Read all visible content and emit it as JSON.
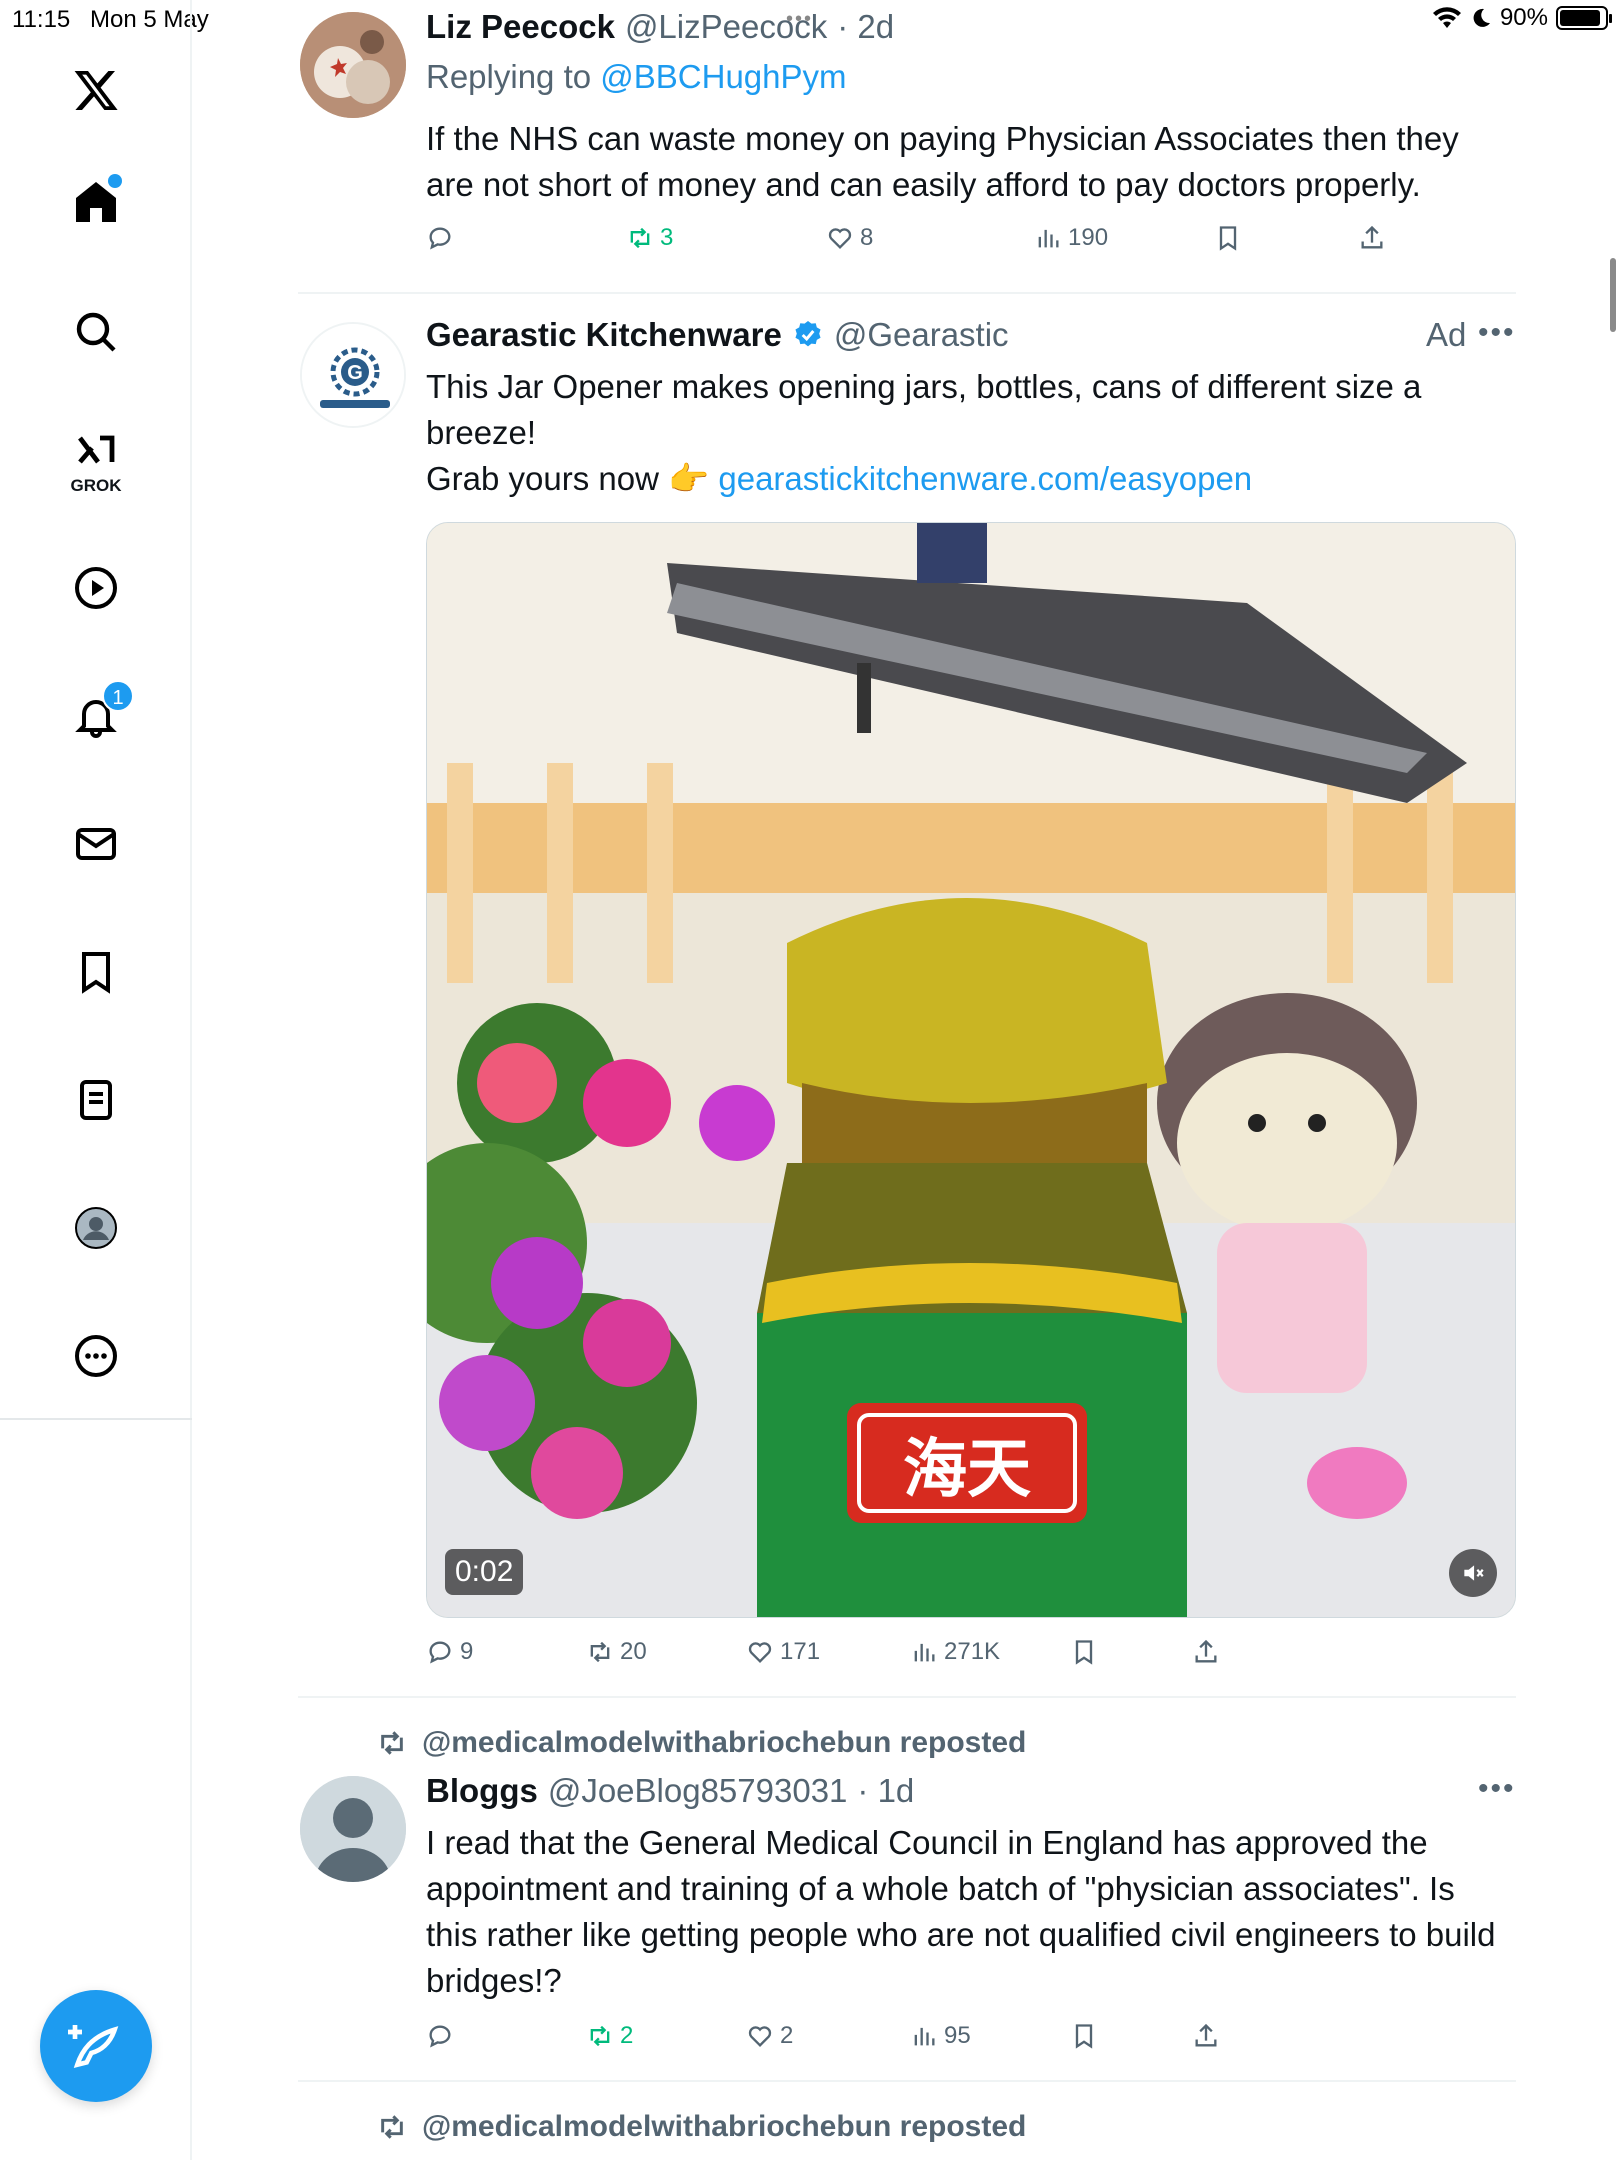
{
  "status_bar": {
    "time": "11:15",
    "date": "Mon 5 May",
    "battery": "90%",
    "battery_level": 0.9
  },
  "sidebar": {
    "grok_label": "GROK",
    "notifications_badge": "1"
  },
  "tweets": [
    {
      "author": "Liz Peecock",
      "handle": "@LizPeecock",
      "age": "· 2d",
      "replying_prefix": "Replying to ",
      "replying_to": "@BBCHughPym",
      "text": "If the NHS can waste money on paying Physician Associates then they are not short of money and can easily afford to pay doctors properly.",
      "reposts": "3",
      "likes": "8",
      "views": "190"
    },
    {
      "author": "Gearastic Kitchenware",
      "handle": "@Gearastic",
      "ad_label": "Ad",
      "text_line1": "This Jar Opener makes opening jars, bottles, cans of different size a breeze!",
      "text_line2_prefix": "Grab yours now 👉 ",
      "link": "gearastickitchenware.com/easyopen",
      "video_time": "0:02",
      "jar_label": "海天",
      "replies": "9",
      "reposts": "20",
      "likes": "171",
      "views": "271K"
    },
    {
      "reposted_by": "@medicalmodelwithabriochebun reposted",
      "author": "Bloggs",
      "handle": "@JoeBlog85793031",
      "age": "· 1d",
      "text": "I read that the General Medical Council in England has approved the appointment and training of a whole batch of \"physician associates\". Is this rather like getting people who are not qualified civil engineers to build bridges!?",
      "reposts": "2",
      "likes": "2",
      "views": "95"
    },
    {
      "reposted_by": "@medicalmodelwithabriochebun reposted"
    }
  ]
}
